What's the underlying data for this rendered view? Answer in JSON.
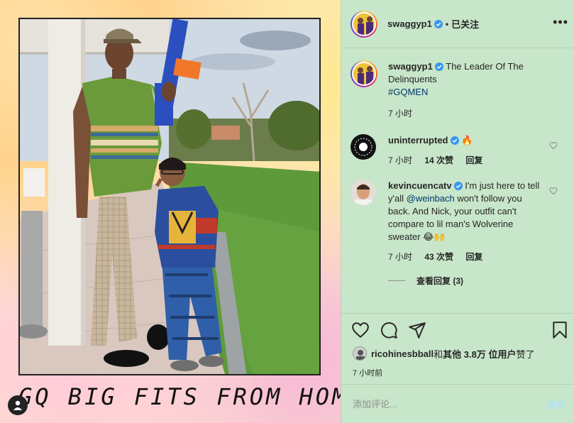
{
  "media": {
    "caption_art": "GQ BIG FITS FROM HOME",
    "user_tag_icon": "user-icon"
  },
  "header": {
    "username": "swaggyp1",
    "verified_icon": "verified-badge-icon",
    "separator": "•",
    "follow_status": "已关注",
    "more_icon": "more-options-icon"
  },
  "post": {
    "author": "swaggyp1",
    "caption": "The Leader Of The Delinquents",
    "hashtag": "#GQMEN",
    "time": "7 小时"
  },
  "comments": [
    {
      "username": "uninterrupted",
      "verified": true,
      "text_emoji": "🔥",
      "time": "7 小时",
      "likes": "14 次赞",
      "reply": "回复"
    },
    {
      "username": "kevincuencatv",
      "verified": true,
      "text_before": "I'm just here to tell y'all ",
      "mention": "@weinbach",
      "text_after": " won't follow you back. And Nick, your outfit can't compare to lil man's Wolverine sweater 😂🙌",
      "time": "7 小时",
      "likes": "43 次赞",
      "reply": "回复",
      "view_replies": "查看回复 (3)"
    }
  ],
  "actions": {
    "like_icon": "heart-icon",
    "comment_icon": "comment-icon",
    "share_icon": "share-icon",
    "save_icon": "bookmark-icon"
  },
  "likes": {
    "liker": "ricohinesbball",
    "connector": " 和 ",
    "others": "其他 3.8万 位用户",
    "suffix": " 赞了"
  },
  "posted_ago": "7 小时前",
  "comment_input": {
    "placeholder": "添加评论...",
    "post_label": "发布"
  },
  "colors": {
    "panel_bg": "#c8e6c9",
    "link": "#00376b",
    "post_btn": "#b2dffc",
    "verified": "#3897f0"
  }
}
